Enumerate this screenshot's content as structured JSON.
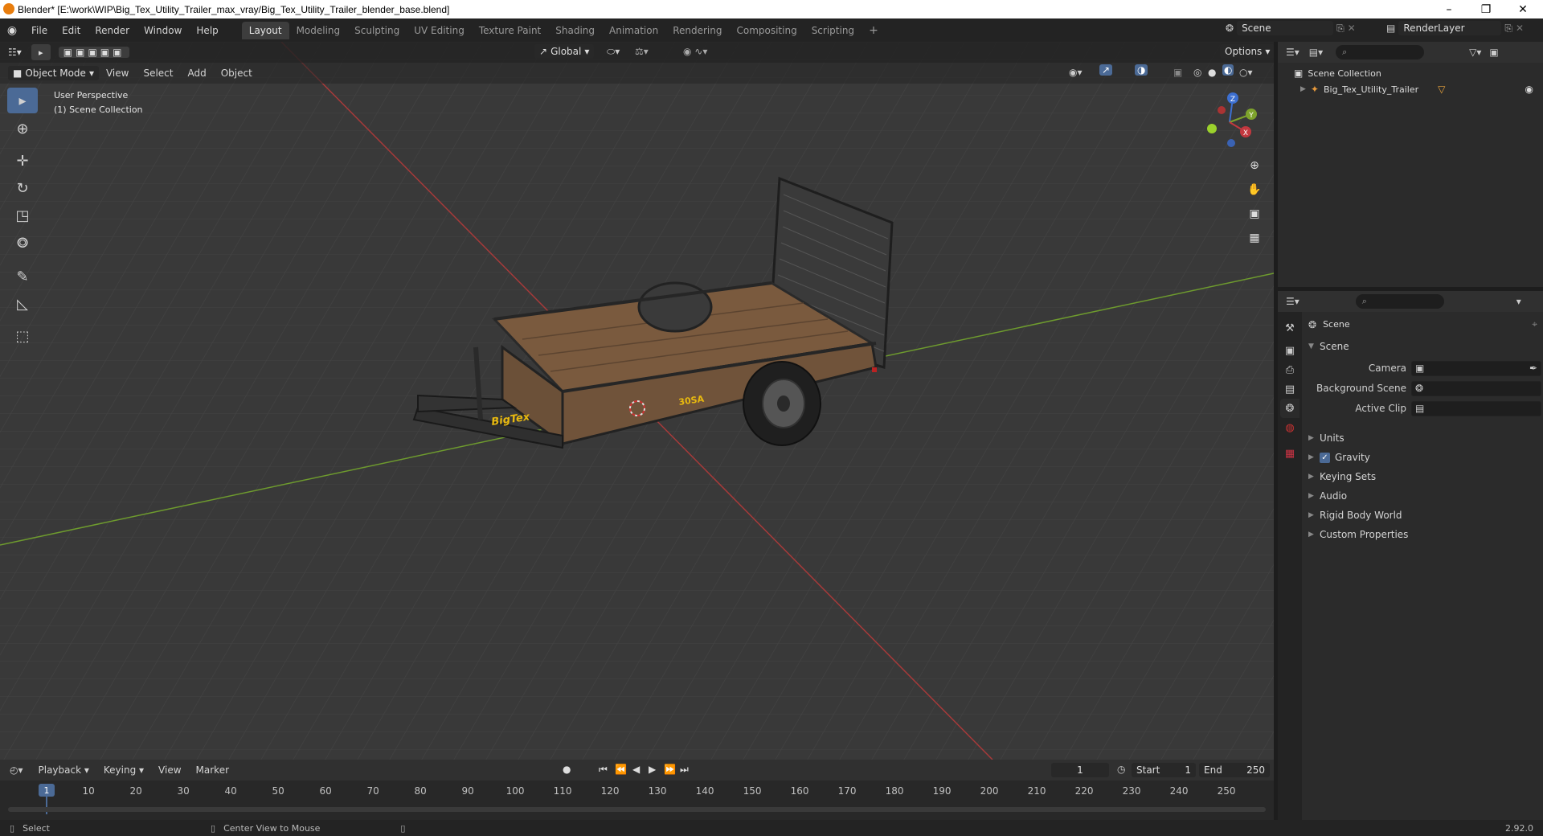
{
  "window": {
    "title": "Blender* [E:\\work\\WIP\\Big_Tex_Utility_Trailer_max_vray/Big_Tex_Utility_Trailer_blender_base.blend]",
    "minimize_icon": "minimize-icon",
    "maximize_icon": "restore-icon",
    "close_icon": "close-icon"
  },
  "menubar": {
    "items": [
      "File",
      "Edit",
      "Render",
      "Window",
      "Help"
    ]
  },
  "workspaces": {
    "tabs": [
      "Layout",
      "Modeling",
      "Sculpting",
      "UV Editing",
      "Texture Paint",
      "Shading",
      "Animation",
      "Rendering",
      "Compositing",
      "Scripting"
    ],
    "active": "Layout",
    "add_label": "+"
  },
  "scene_selector": {
    "value": "Scene"
  },
  "layer_selector": {
    "value": "RenderLayer"
  },
  "viewport": {
    "mode": "Object Mode",
    "menus": [
      "View",
      "Select",
      "Add",
      "Object"
    ],
    "transform_orientation": "Global",
    "options_label": "Options",
    "overlay_line1": "User Perspective",
    "overlay_line2": "(1) Scene Collection",
    "decal_brand": "BigTex",
    "decal_model": "30SA",
    "gizmo": {
      "x": "X",
      "y": "Y",
      "z": "Z"
    },
    "colors": {
      "background": "#393939",
      "grid": "#454545",
      "x_axis": "#b33b3b",
      "y_axis": "#6e9b2e"
    }
  },
  "toolbar": {
    "tools": [
      "select-box-icon",
      "cursor-icon",
      "move-icon",
      "rotate-icon",
      "scale-icon",
      "transform-icon",
      "annotate-icon",
      "measure-icon",
      "add-cube-icon"
    ]
  },
  "outliner": {
    "root": "Scene Collection",
    "items": [
      {
        "label": "Big_Tex_Utility_Trailer"
      }
    ]
  },
  "properties": {
    "context": "Scene",
    "section": "Scene",
    "fields": [
      {
        "label": "Camera"
      },
      {
        "label": "Background Scene"
      },
      {
        "label": "Active Clip"
      }
    ],
    "panels": [
      {
        "label": "Units",
        "checkbox": false
      },
      {
        "label": "Gravity",
        "checkbox": true,
        "checked": true
      },
      {
        "label": "Keying Sets",
        "checkbox": false
      },
      {
        "label": "Audio",
        "checkbox": false
      },
      {
        "label": "Rigid Body World",
        "checkbox": false
      },
      {
        "label": "Custom Properties",
        "checkbox": false
      }
    ]
  },
  "timeline": {
    "menus": [
      "Playback",
      "Keying",
      "View",
      "Marker"
    ],
    "current_frame": "1",
    "start_label": "Start",
    "start_value": "1",
    "end_label": "End",
    "end_value": "250",
    "ticks": [
      "1",
      "10",
      "20",
      "30",
      "40",
      "50",
      "60",
      "70",
      "80",
      "90",
      "100",
      "110",
      "120",
      "130",
      "140",
      "150",
      "160",
      "170",
      "180",
      "190",
      "200",
      "210",
      "220",
      "230",
      "240",
      "250"
    ]
  },
  "statusbar": {
    "left": "Select",
    "middle": "Center View to Mouse",
    "version": "2.92.0"
  }
}
